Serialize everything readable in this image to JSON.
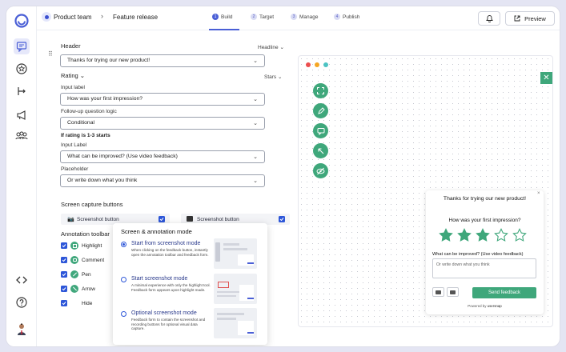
{
  "header": {
    "breadcrumb_team": "Product team",
    "breadcrumb_page": "Feature release",
    "preview_label": "Preview"
  },
  "steps": [
    {
      "num": "1",
      "label": "Build"
    },
    {
      "num": "2",
      "label": "Target"
    },
    {
      "num": "3",
      "label": "Manage"
    },
    {
      "num": "4",
      "label": "Publish"
    }
  ],
  "form": {
    "header_section": "Header",
    "header_type": "Headline",
    "header_value": "Thanks for trying our new product!",
    "rating_section": "Rating",
    "rating_type": "Stars",
    "input_label_1": "Input label",
    "input_value_1": "How was your first impression?",
    "followup_label": "Follow-up question logic",
    "followup_value": "Conditional",
    "condition_text": "If rating is 1-3 starts",
    "input_label_2": "Input Label",
    "input_value_2": "What can be improved? (Use video feedback)",
    "placeholder_label": "Placeholder",
    "placeholder_value": "Or write down what you think",
    "screen_capture_title": "Screen capture buttons",
    "capture_btn_1": "Screenshot button",
    "capture_btn_2": "Screenshot button",
    "annotation_title": "Annotation toolbar",
    "tools": [
      "Highlight",
      "Comment",
      "Pen",
      "Arrow",
      "Hide"
    ]
  },
  "popup": {
    "title": "Screen & annotation mode",
    "options": [
      {
        "title": "Start from screenshot mode",
        "desc": "When clicking on the feedback button, instantly open the annotation toolbar and feedback form."
      },
      {
        "title": "Start screenshot mode",
        "desc": "A minimal experience with only the highlight tool. Feedback form appears upon highlight made."
      },
      {
        "title": "Optional screenshot mode",
        "desc": "Feedback form to contain the screenshot and recording buttons for optional visual data capture."
      }
    ]
  },
  "widget": {
    "title": "Thanks for trying our new product!",
    "question": "How was your first impression?",
    "rating": 3,
    "max_rating": 5,
    "followup": "What can be improved? (Use video feedback)",
    "textarea_placeholder": "Or write down what you think",
    "send_label": "Send feedback",
    "powered_by": "Powered by",
    "brand": "usersnap"
  },
  "colors": {
    "accent": "#2d56d8",
    "green": "#3fa77b",
    "brand": "#4a5fd6"
  }
}
